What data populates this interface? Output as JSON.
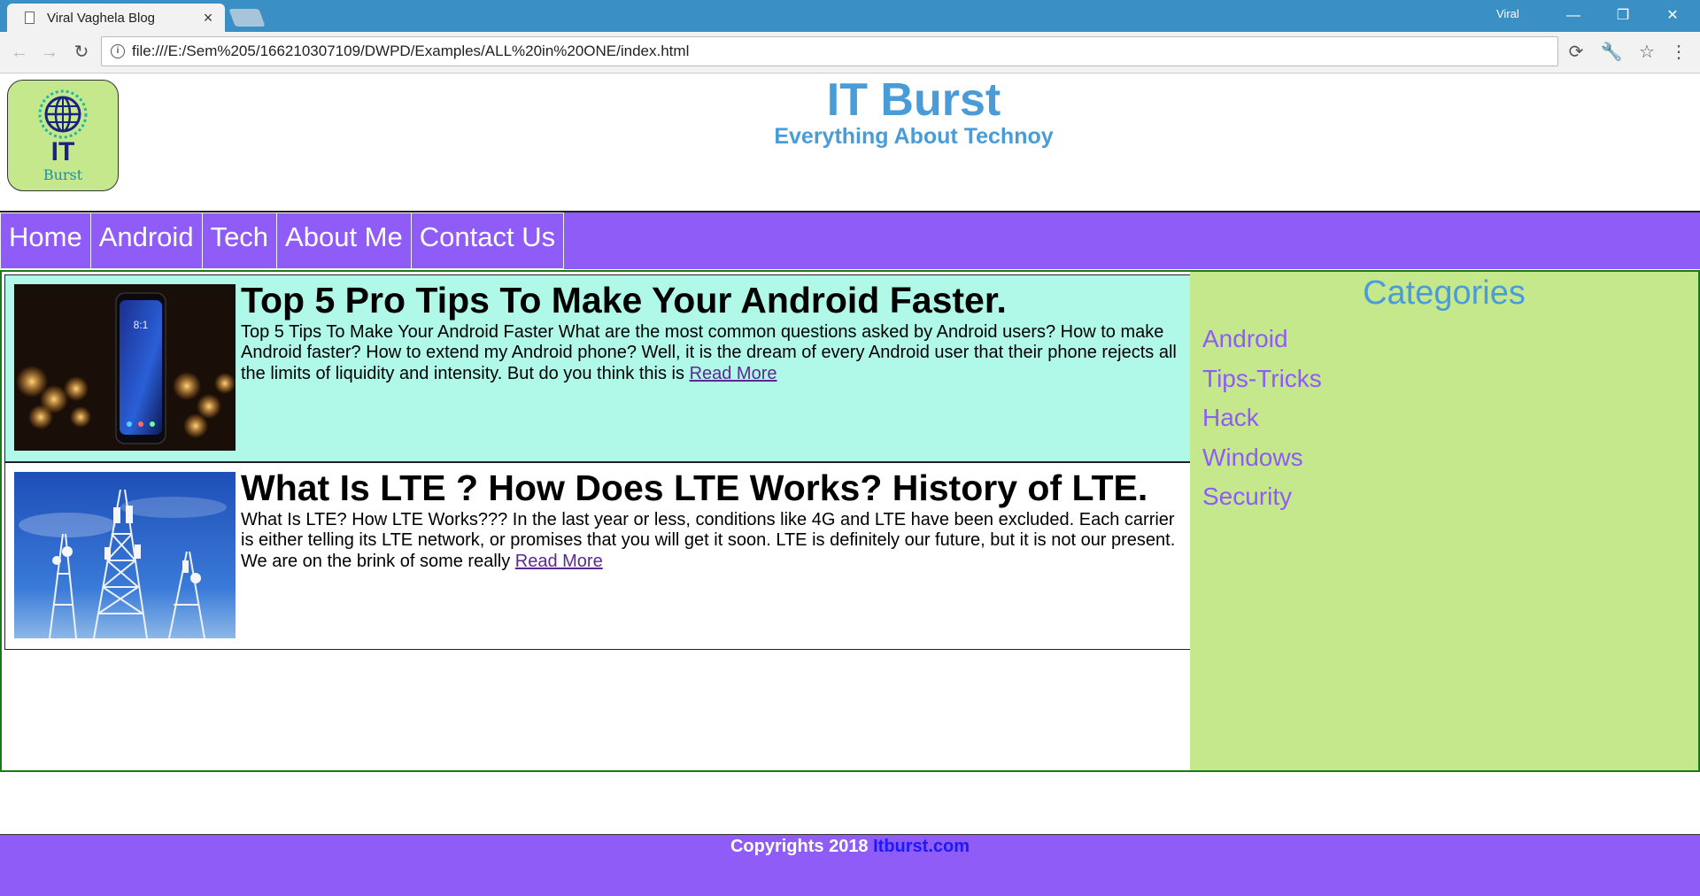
{
  "browser": {
    "tab_title": "Viral Vaghela Blog",
    "tab_close": "×",
    "profile_name": "Viral",
    "url": "file:///E:/Sem%205/166210307109/DWPD/Examples/ALL%20in%20ONE/index.html"
  },
  "site": {
    "logo_text": "IT",
    "logo_subtext": "Burst",
    "title": "IT Burst",
    "tagline": "Everything About Technoy"
  },
  "nav": {
    "items": [
      "Home",
      "Android",
      "Tech",
      "About Me",
      "Contact Us"
    ]
  },
  "articles": [
    {
      "title": "Top 5 Pro Tips To Make Your Android Faster.",
      "body": "Top 5 Tips To Make Your Android Faster What are the most common questions asked by Android users? How to make Android faster? How to extend my Android phone? Well, it is the dream of every Android user that their phone rejects all the limits of liquidity and intensity. But do you think this is",
      "read_more": "Read More",
      "phone_time": "8:1"
    },
    {
      "title": "What Is LTE ? How Does LTE Works? History of LTE.",
      "body": "What Is LTE? How LTE Works??? In the last year or less, conditions like 4G and LTE have been excluded. Each carrier is either telling its LTE network, or promises that you will get it soon. LTE is definitely our future, but it is not our present. We are on the brink of some really",
      "read_more": "Read More"
    }
  ],
  "sidebar": {
    "heading": "Categories",
    "categories": [
      "Android",
      "Tips-Tricks",
      "Hack",
      "Windows",
      "Security"
    ]
  },
  "footer": {
    "text": "Copyrights 2018",
    "link": "Itburst.com"
  },
  "colors": {
    "nav_bg": "#8f5cf8",
    "accent_blue": "#4a9cd9",
    "article_highlight": "#b0f8e8",
    "sidebar_bg": "#c6e88c",
    "content_border": "#1a7a1a"
  }
}
